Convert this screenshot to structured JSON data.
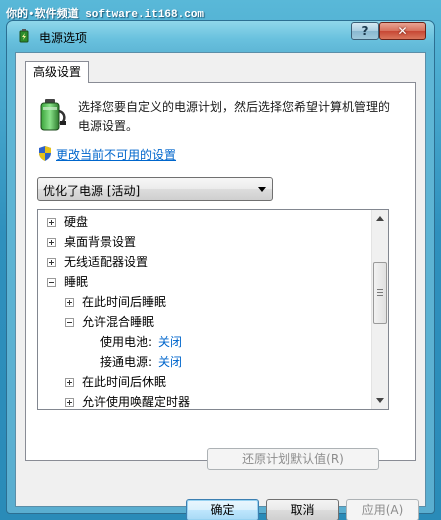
{
  "watermark": "你的•软件频道 software.it168.com",
  "window": {
    "title": "电源选项",
    "help_label": "?",
    "close_label": "✕"
  },
  "tab": {
    "label": "高级设置"
  },
  "intro": {
    "text": "选择您要自定义的电源计划，然后选择您希望计算机管理的电源设置。"
  },
  "link": {
    "text": "更改当前不可用的设置"
  },
  "plan_select": {
    "value": "优化了电源 [活动]"
  },
  "tree": {
    "items": [
      {
        "label": "硬盘",
        "expander": "plus",
        "level": 0
      },
      {
        "label": "桌面背景设置",
        "expander": "plus",
        "level": 0
      },
      {
        "label": "无线适配器设置",
        "expander": "plus",
        "level": 0
      },
      {
        "label": "睡眠",
        "expander": "minus",
        "level": 0
      },
      {
        "label": "在此时间后睡眠",
        "expander": "plus",
        "level": 1
      },
      {
        "label": "允许混合睡眠",
        "expander": "minus",
        "level": 1
      },
      {
        "label": "使用电池:",
        "value": "关闭",
        "expander": "none",
        "level": 2
      },
      {
        "label": "接通电源:",
        "value": "关闭",
        "expander": "none",
        "level": 2
      },
      {
        "label": "在此时间后休眠",
        "expander": "plus",
        "level": 1
      },
      {
        "label": "允许使用唤醒定时器",
        "expander": "plus",
        "level": 1
      }
    ]
  },
  "buttons": {
    "restore": "还原计划默认值(R)",
    "ok": "确定",
    "cancel": "取消",
    "apply": "应用(A)"
  },
  "colors": {
    "link": "#0066cc",
    "titlebar": "#69c1de",
    "close_button": "#c74734"
  },
  "icons": {
    "title": "battery-power-icon",
    "intro": "battery-plan-icon",
    "link": "uac-shield-icon"
  }
}
